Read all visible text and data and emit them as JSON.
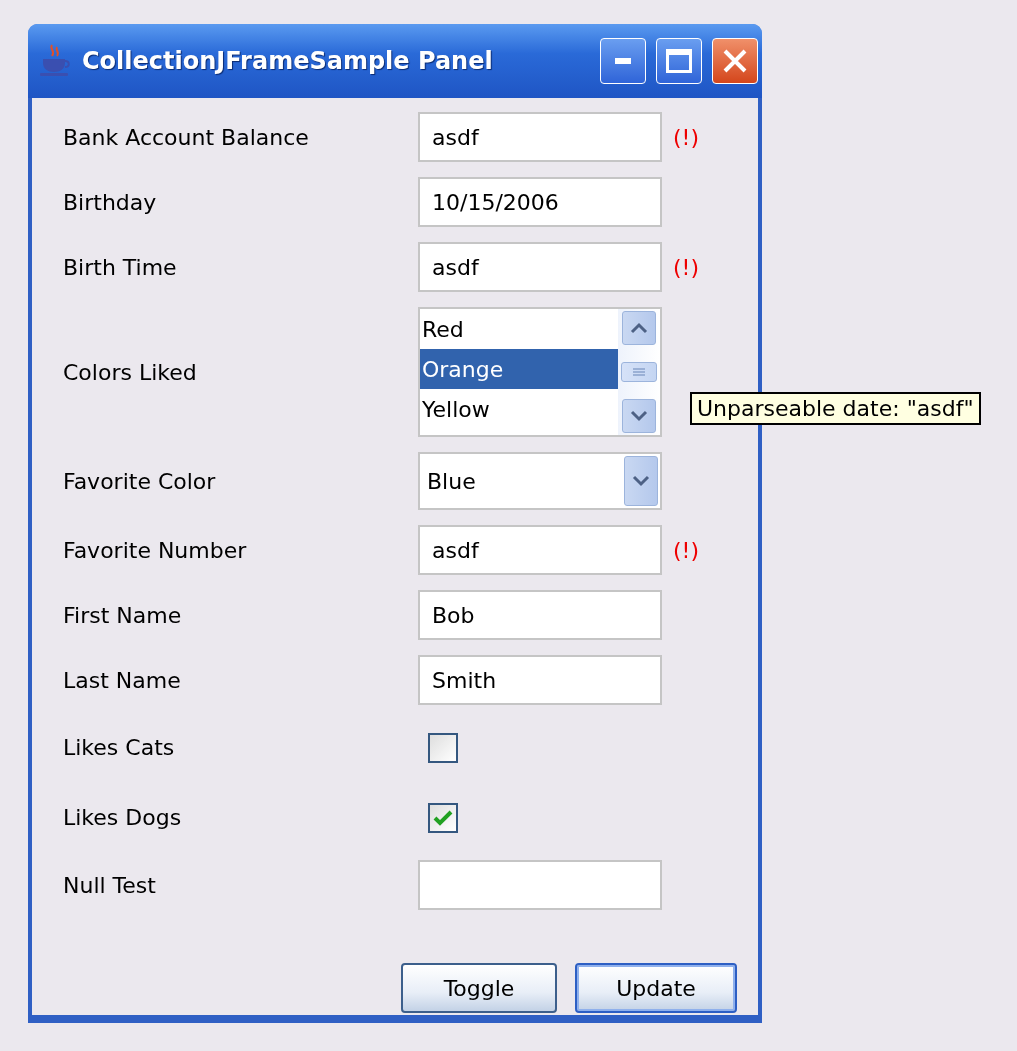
{
  "window": {
    "title": "CollectionJFrameSample Panel"
  },
  "rows": [
    {
      "kind": "text",
      "label": "Bank Account Balance",
      "value": "asdf",
      "error": "(!)"
    },
    {
      "kind": "text",
      "label": "Birthday",
      "value": "10/15/2006"
    },
    {
      "kind": "text",
      "label": "Birth Time",
      "value": "asdf",
      "error": "(!)"
    },
    {
      "kind": "list",
      "label": "Colors Liked",
      "items": [
        {
          "label": "Red",
          "selected": false
        },
        {
          "label": "Orange",
          "selected": true
        },
        {
          "label": "Yellow",
          "selected": false
        }
      ]
    },
    {
      "kind": "combo",
      "label": "Favorite Color",
      "value": "Blue"
    },
    {
      "kind": "text",
      "label": "Favorite Number",
      "value": "asdf",
      "error": "(!)"
    },
    {
      "kind": "text",
      "label": "First Name",
      "value": "Bob"
    },
    {
      "kind": "text",
      "label": "Last Name",
      "value": "Smith"
    },
    {
      "kind": "checkbox",
      "label": "Likes Cats",
      "checked": false
    },
    {
      "kind": "checkbox",
      "label": "Likes Dogs",
      "checked": true
    },
    {
      "kind": "text",
      "label": "Null Test"
    }
  ],
  "buttons": [
    {
      "label": "Toggle",
      "default": false
    },
    {
      "label": "Update",
      "default": true
    }
  ],
  "tooltip": "Unparseable date: \"asdf\""
}
